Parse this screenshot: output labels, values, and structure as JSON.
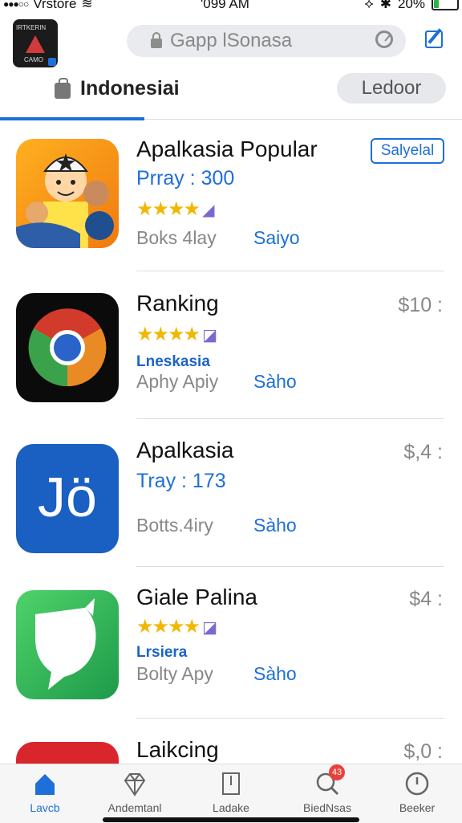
{
  "status_bar": {
    "carrier": "Vrstore",
    "time": "'099 AM",
    "battery_percent": "20%",
    "battery_level": 0.2,
    "battery_color": "#27b24a"
  },
  "header": {
    "search_placeholder": "Gapp lSonasa",
    "logo_text": "IRTKERIN",
    "logo_sub": "CAMO"
  },
  "tabs": {
    "region_label": "Indonesiai",
    "pill_label": "Ledoor"
  },
  "apps": [
    {
      "title": "Apalkasia Popular",
      "sub": "Prray : 300",
      "stars": "★★★★",
      "meta_left": "Boks 4lay",
      "meta_right": "Saiyo",
      "action": "Salyelal"
    },
    {
      "title": "Ranking",
      "stars": "★★★★",
      "category": "Lneskasia",
      "meta_left": "Aphy Apiy",
      "meta_right": "Sàho",
      "price": "$10 :"
    },
    {
      "title": "Apalkasia",
      "sub": "Tray : 173",
      "meta_left": "Botts.4iry",
      "meta_right": "Sàho",
      "price": "$,4 :",
      "icon_text": "Jö"
    },
    {
      "title": "Giale Palina",
      "stars": "★★★★",
      "category": "Lrsiera",
      "meta_left": "Bolty Apy",
      "meta_right": "Sàho",
      "price": "$4 :"
    },
    {
      "title": "Laikcing",
      "price": "$,0 :"
    }
  ],
  "bottom_tabs": [
    {
      "label": "Lavcb",
      "icon": "home-icon"
    },
    {
      "label": "Andemtanl",
      "icon": "diamond-icon"
    },
    {
      "label": "Ladake",
      "icon": "document-icon"
    },
    {
      "label": "BiedNsas",
      "icon": "search-icon",
      "badge": "43"
    },
    {
      "label": "Beeker",
      "icon": "clock-icon"
    }
  ],
  "colors": {
    "accent": "#1e6fd9",
    "star": "#f2b705"
  }
}
